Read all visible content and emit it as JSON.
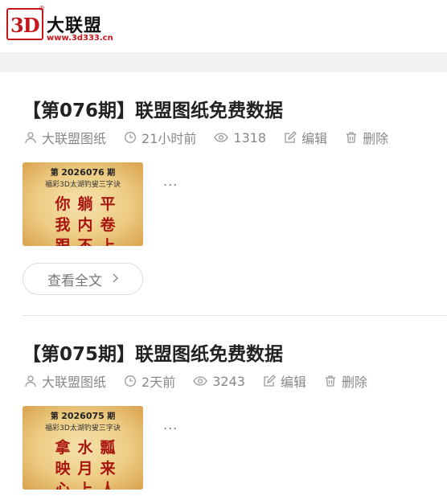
{
  "site": {
    "logo_mark": "3D",
    "logo_reg": "®",
    "logo_name": "大联盟",
    "logo_url": "www.3d333.cn"
  },
  "posts": [
    {
      "title": "【第076期】联盟图纸免费数据",
      "author": "大联盟图纸",
      "time": "21小时前",
      "views": "1318",
      "edit_label": "编辑",
      "delete_label": "删除",
      "excerpt": "...",
      "thumb": {
        "period_prefix": "第",
        "period_number": "2026076",
        "period_suffix": "期",
        "subtitle": "福彩3D太湖钓叟三字诀",
        "chars": [
          "你",
          "躺",
          "平",
          "我",
          "内",
          "卷",
          "跟",
          "不",
          "上"
        ]
      },
      "read_more": "查看全文"
    },
    {
      "title": "【第075期】联盟图纸免费数据",
      "author": "大联盟图纸",
      "time": "2天前",
      "views": "3243",
      "edit_label": "编辑",
      "delete_label": "删除",
      "excerpt": "...",
      "thumb": {
        "period_prefix": "第",
        "period_number": "2026075",
        "period_suffix": "期",
        "subtitle": "福彩3D太湖钓叟三字诀",
        "chars": [
          "拿",
          "水",
          "瓢",
          "映",
          "月",
          "来",
          "心",
          "上",
          "人"
        ]
      }
    }
  ],
  "icons": {
    "author": "user-icon",
    "time": "clock-icon",
    "views": "eye-icon",
    "edit": "edit-icon",
    "delete": "trash-icon",
    "read_more": "chevron-right-icon"
  },
  "colors": {
    "brand_red": "#c4161c",
    "thumb_char": "#a8160f",
    "meta_gray": "#888888"
  }
}
